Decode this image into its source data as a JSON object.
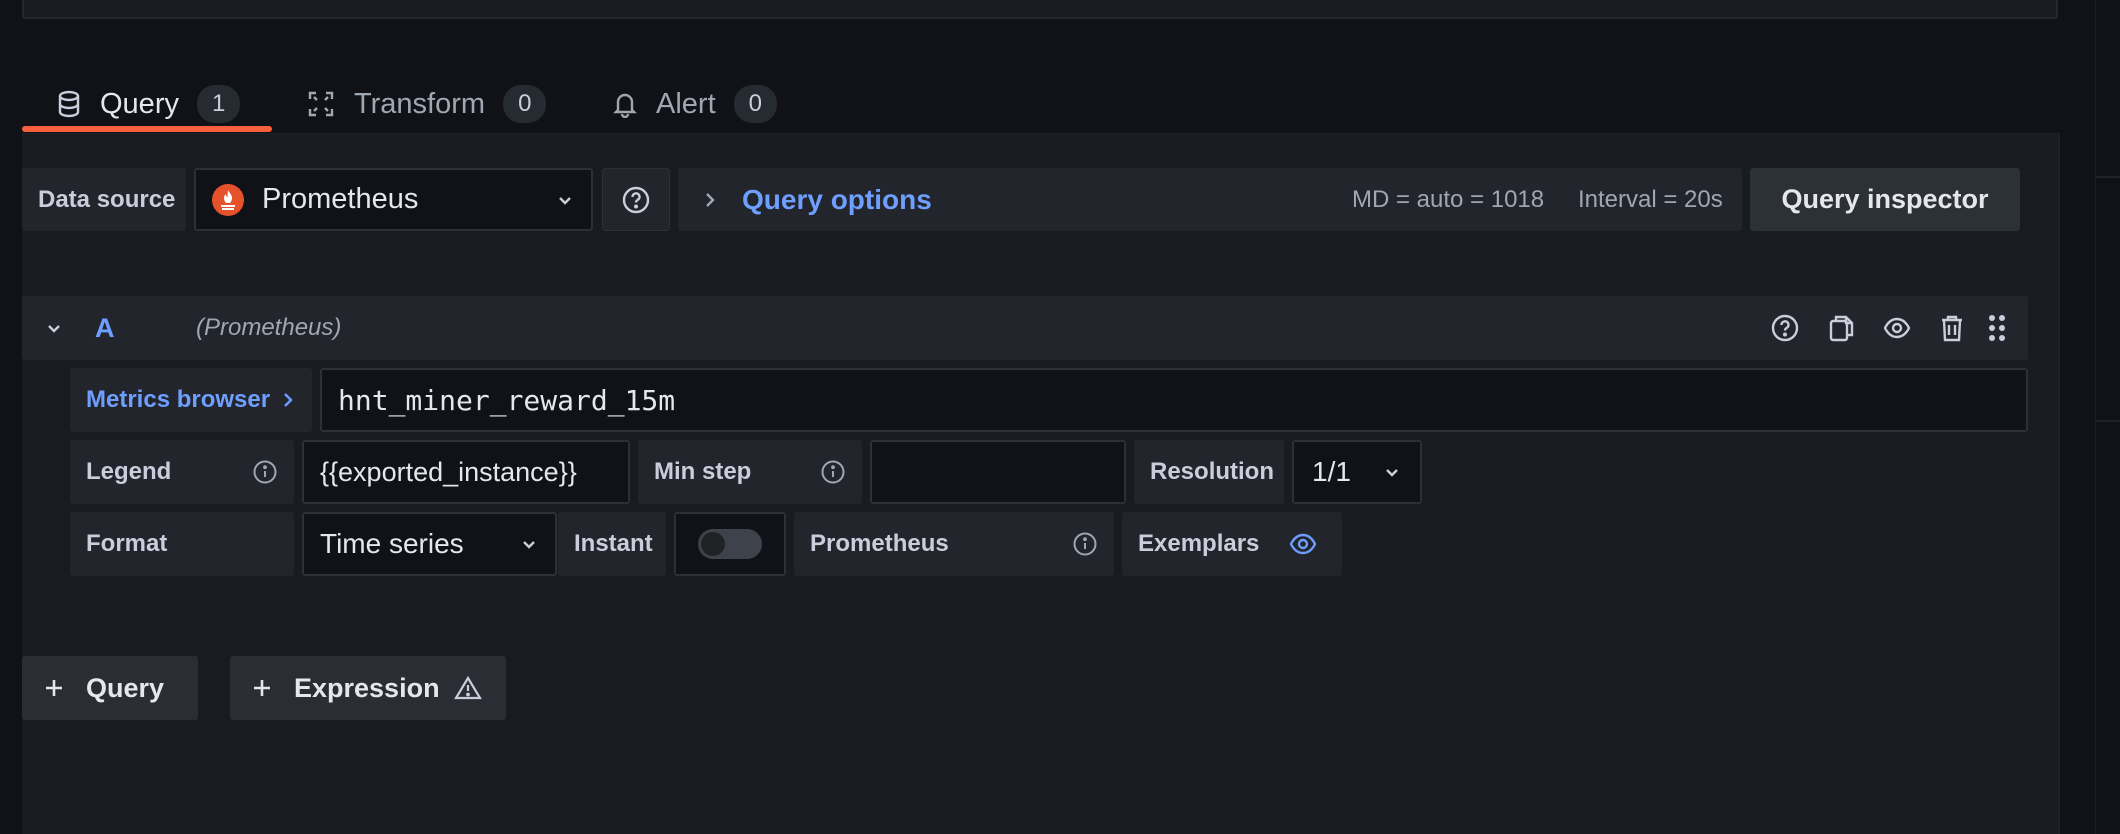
{
  "tabs": [
    {
      "label": "Query",
      "count": "1",
      "icon": "database-icon"
    },
    {
      "label": "Transform",
      "count": "0",
      "icon": "transform-icon"
    },
    {
      "label": "Alert",
      "count": "0",
      "icon": "bell-icon"
    }
  ],
  "toolbar": {
    "data_source_label": "Data source",
    "data_source_value": "Prometheus",
    "query_options_label": "Query options",
    "md_text": "MD = auto = 1018",
    "interval_text": "Interval = 20s",
    "query_inspector_label": "Query inspector"
  },
  "query_row": {
    "ref_id": "A",
    "datasource_hint": "(Prometheus)",
    "metrics_browser_label": "Metrics browser",
    "expression": "hnt_miner_reward_15m",
    "legend_label": "Legend",
    "legend_value": "{{exported_instance}}",
    "min_step_label": "Min step",
    "min_step_value": "",
    "resolution_label": "Resolution",
    "resolution_value": "1/1",
    "format_label": "Format",
    "format_value": "Time series",
    "instant_label": "Instant",
    "instant_on": false,
    "prometheus_label": "Prometheus",
    "exemplars_label": "Exemplars"
  },
  "actions": {
    "add_query_label": "Query",
    "add_expression_label": "Expression"
  },
  "colors": {
    "accent": "#6e9fff",
    "tab_active": "#f55f3e",
    "prometheus_logo": "#e6522c",
    "background": "#111217",
    "panel": "#181b1f"
  }
}
